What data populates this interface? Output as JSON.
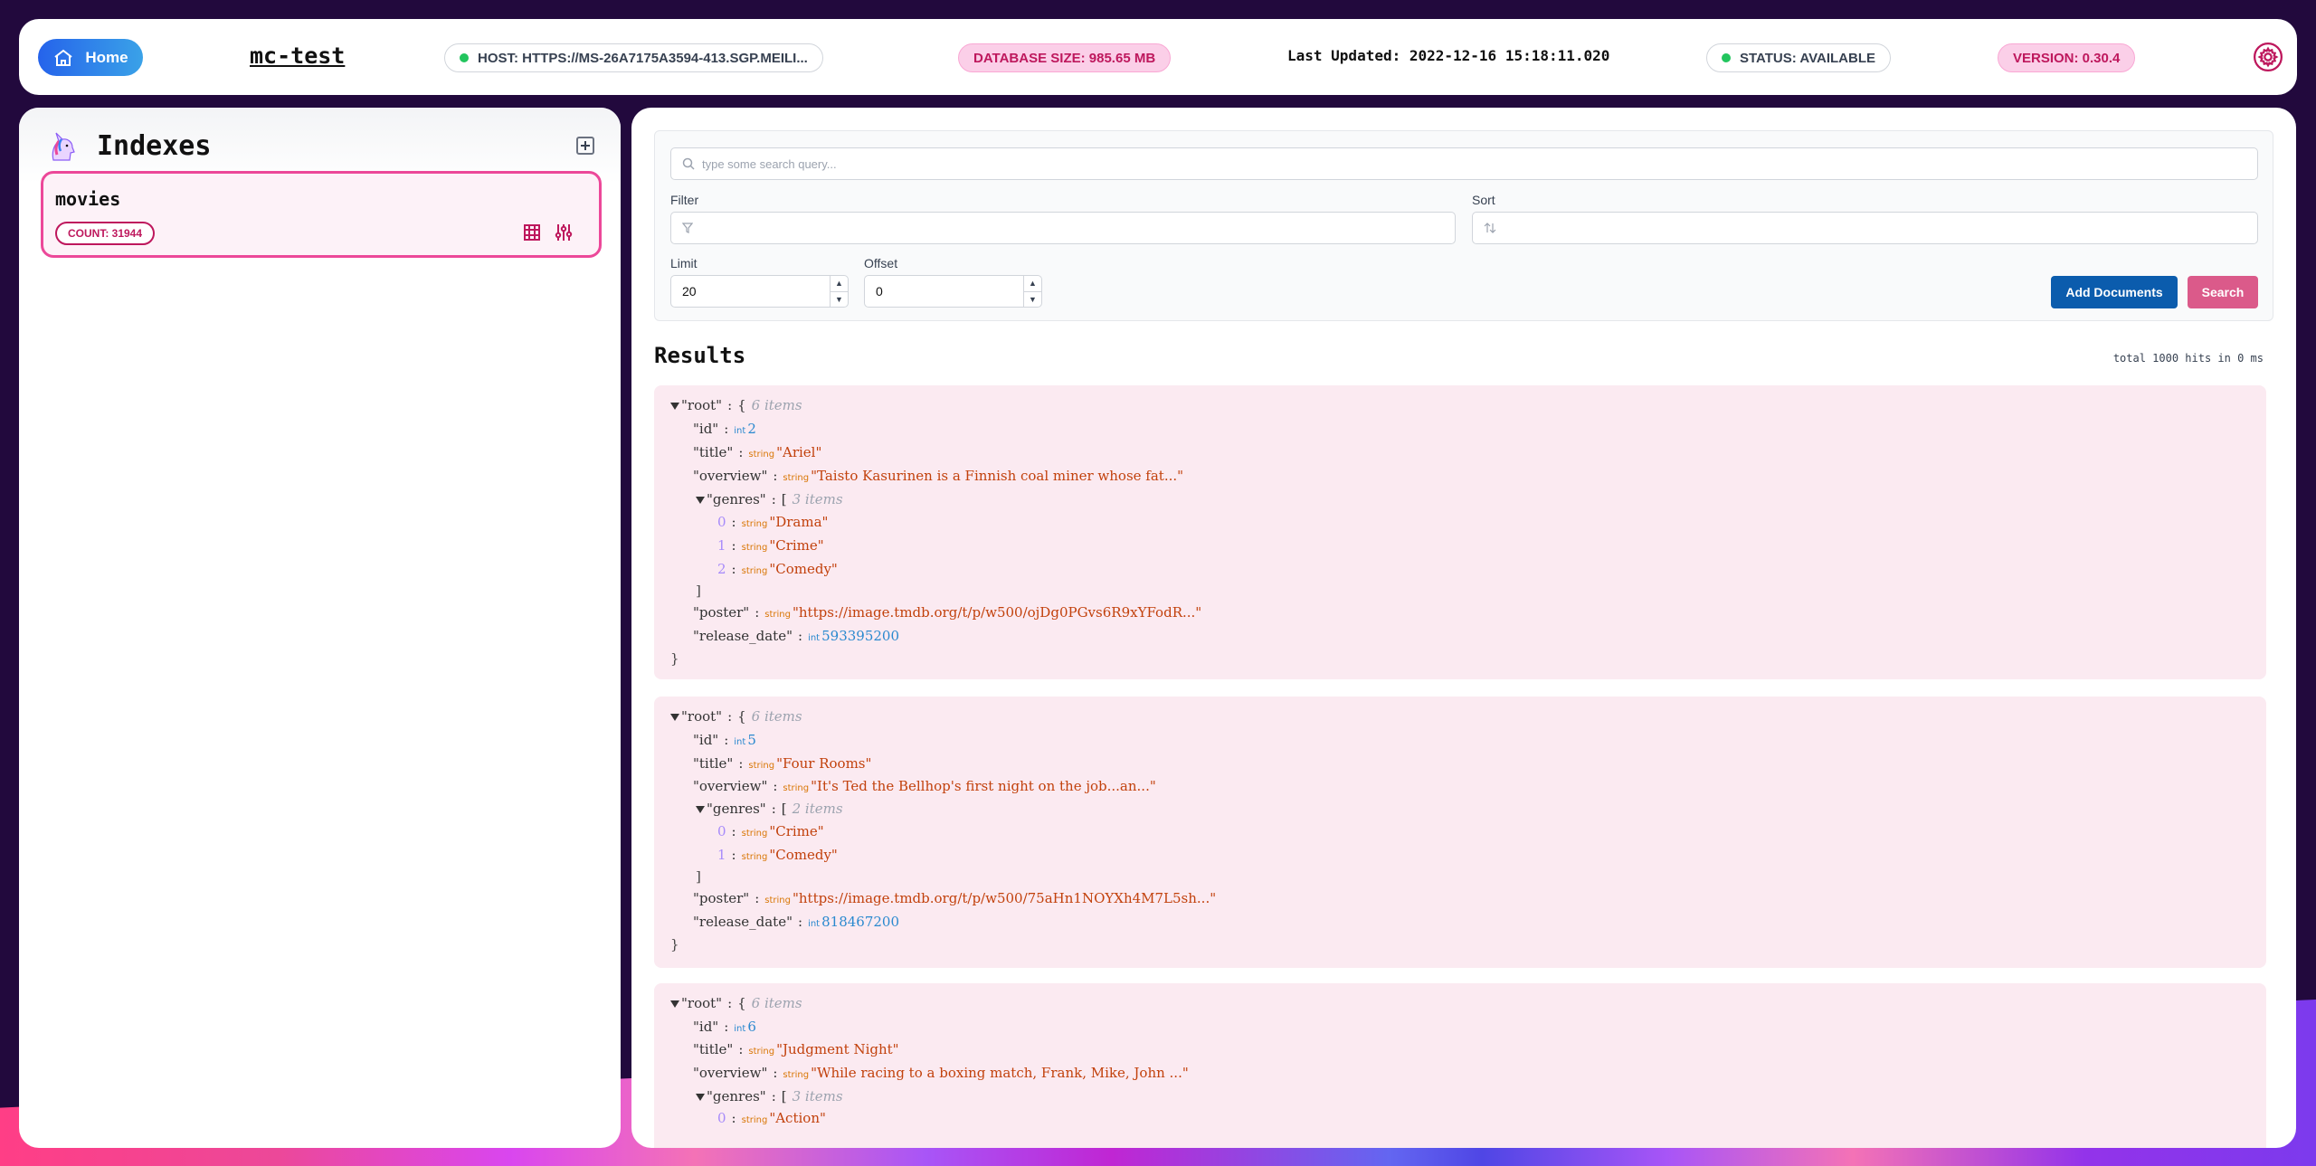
{
  "header": {
    "home_label": "Home",
    "app_title": "mc-test",
    "host_label": "HOST: HTTPS://MS-26A7175A3594-413.SGP.MEILI...",
    "db_size_label": "DATABASE SIZE: 985.65 MB",
    "last_updated_label": "Last Updated: 2022-12-16 15:18:11.020",
    "status_label": "STATUS: AVAILABLE",
    "version_label": "VERSION: 0.30.4"
  },
  "sidebar": {
    "title": "Indexes",
    "indexes": [
      {
        "name": "movies",
        "count_label": "COUNT: 31944"
      }
    ]
  },
  "search": {
    "query_placeholder": "type some search query...",
    "filter_label": "Filter",
    "sort_label": "Sort",
    "limit_label": "Limit",
    "limit_value": "20",
    "offset_label": "Offset",
    "offset_value": "0",
    "add_documents_label": "Add Documents",
    "search_label": "Search"
  },
  "results": {
    "title": "Results",
    "meta": "total 1000 hits in 0 ms",
    "items": [
      {
        "root_key": "\"root\"",
        "root_meta": "6 items",
        "id": "2",
        "title": "\"Ariel\"",
        "overview": "\"Taisto Kasurinen is a Finnish coal miner whose fat...\"",
        "genres_meta": "3 items",
        "genres": [
          "\"Drama\"",
          "\"Crime\"",
          "\"Comedy\""
        ],
        "poster": "\"https://image.tmdb.org/t/p/w500/ojDg0PGvs6R9xYFodR...\"",
        "release_date": "593395200"
      },
      {
        "root_key": "\"root\"",
        "root_meta": "6 items",
        "id": "5",
        "title": "\"Four Rooms\"",
        "overview": "\"It's Ted the Bellhop's first night on the job...an...\"",
        "genres_meta": "2 items",
        "genres": [
          "\"Crime\"",
          "\"Comedy\""
        ],
        "poster": "\"https://image.tmdb.org/t/p/w500/75aHn1NOYXh4M7L5sh...\"",
        "release_date": "818467200"
      },
      {
        "root_key": "\"root\"",
        "root_meta": "6 items",
        "id": "6",
        "title": "\"Judgment Night\"",
        "overview": "\"While racing to a boxing match, Frank, Mike, John ...\"",
        "genres_meta": "3 items",
        "genres": [
          "\"Action\""
        ]
      }
    ],
    "labels": {
      "id_key": "\"id\"",
      "title_key": "\"title\"",
      "overview_key": "\"overview\"",
      "genres_key": "\"genres\"",
      "poster_key": "\"poster\"",
      "release_date_key": "\"release_date\"",
      "type_int": "int",
      "type_string": "string",
      "open_brace": "{",
      "close_brace": "}",
      "open_bracket": "[",
      "close_bracket": "]"
    }
  },
  "colors": {
    "accent_pink": "#ec4899",
    "status_green": "#22c55e",
    "primary_blue": "#0b5cad",
    "background": "#22093d"
  }
}
